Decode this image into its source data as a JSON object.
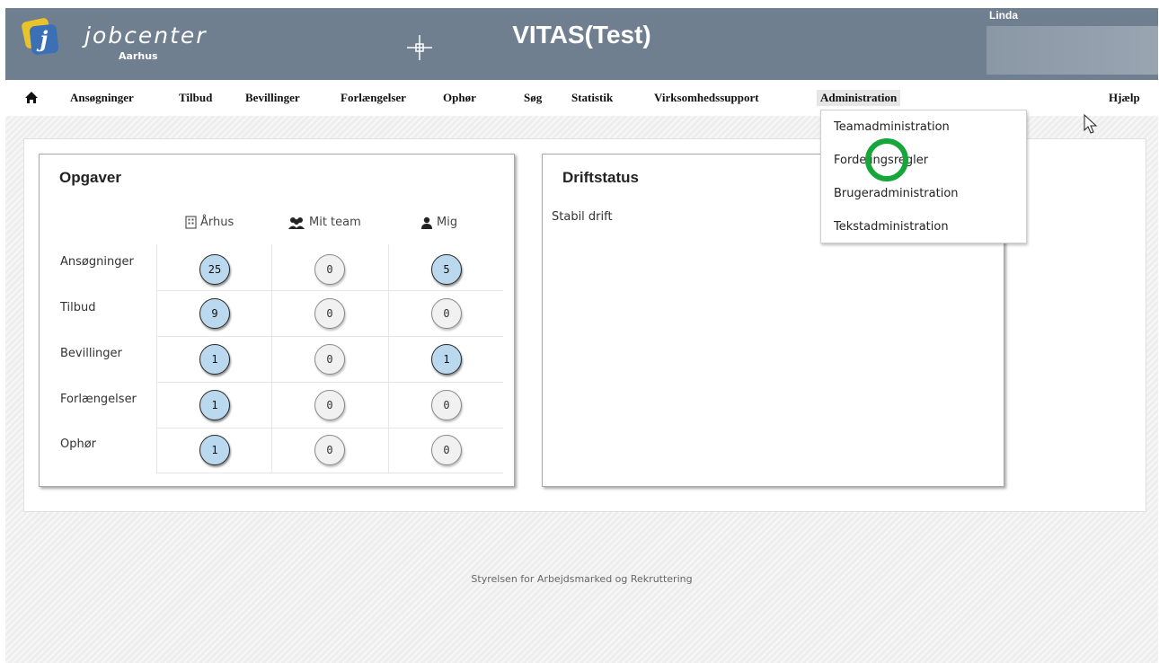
{
  "header": {
    "brand": "jobcenter",
    "brand_sub": "Aarhus",
    "app_title": "VITAS(Test)",
    "user": "Linda"
  },
  "nav": {
    "items": [
      {
        "label": "Ansøgninger"
      },
      {
        "label": "Tilbud"
      },
      {
        "label": "Bevillinger"
      },
      {
        "label": "Forlængelser"
      },
      {
        "label": "Ophør"
      },
      {
        "label": "Søg"
      },
      {
        "label": "Statistik"
      },
      {
        "label": "Virksomhedssupport"
      },
      {
        "label": "Administration"
      }
    ],
    "help": "Hjælp"
  },
  "admin_menu": {
    "items": [
      {
        "label": "Teamadministration"
      },
      {
        "label": "Fordelingsregler"
      },
      {
        "label": "Brugeradministration"
      },
      {
        "label": "Tekstadministration"
      }
    ]
  },
  "tasks": {
    "title": "Opgaver",
    "columns": [
      {
        "label": "Århus",
        "icon": "building-icon"
      },
      {
        "label": "Mit team",
        "icon": "team-icon"
      },
      {
        "label": "Mig",
        "icon": "user-icon"
      }
    ],
    "rows": [
      {
        "label": "Ansøgninger",
        "values": [
          "25",
          "0",
          "5"
        ]
      },
      {
        "label": "Tilbud",
        "values": [
          "9",
          "0",
          "0"
        ]
      },
      {
        "label": "Bevillinger",
        "values": [
          "1",
          "0",
          "1"
        ]
      },
      {
        "label": "Forlængelser",
        "values": [
          "1",
          "0",
          "0"
        ]
      },
      {
        "label": "Ophør",
        "values": [
          "1",
          "0",
          "0"
        ]
      }
    ]
  },
  "status": {
    "title": "Driftstatus",
    "text": "Stabil drift"
  },
  "footer": {
    "text": "Styrelsen for Arbejdsmarked og Rekruttering"
  },
  "colors": {
    "header_bg": "#6f7f8f",
    "badge_active": "#bad8ee",
    "highlight_circle": "#16a63a"
  }
}
